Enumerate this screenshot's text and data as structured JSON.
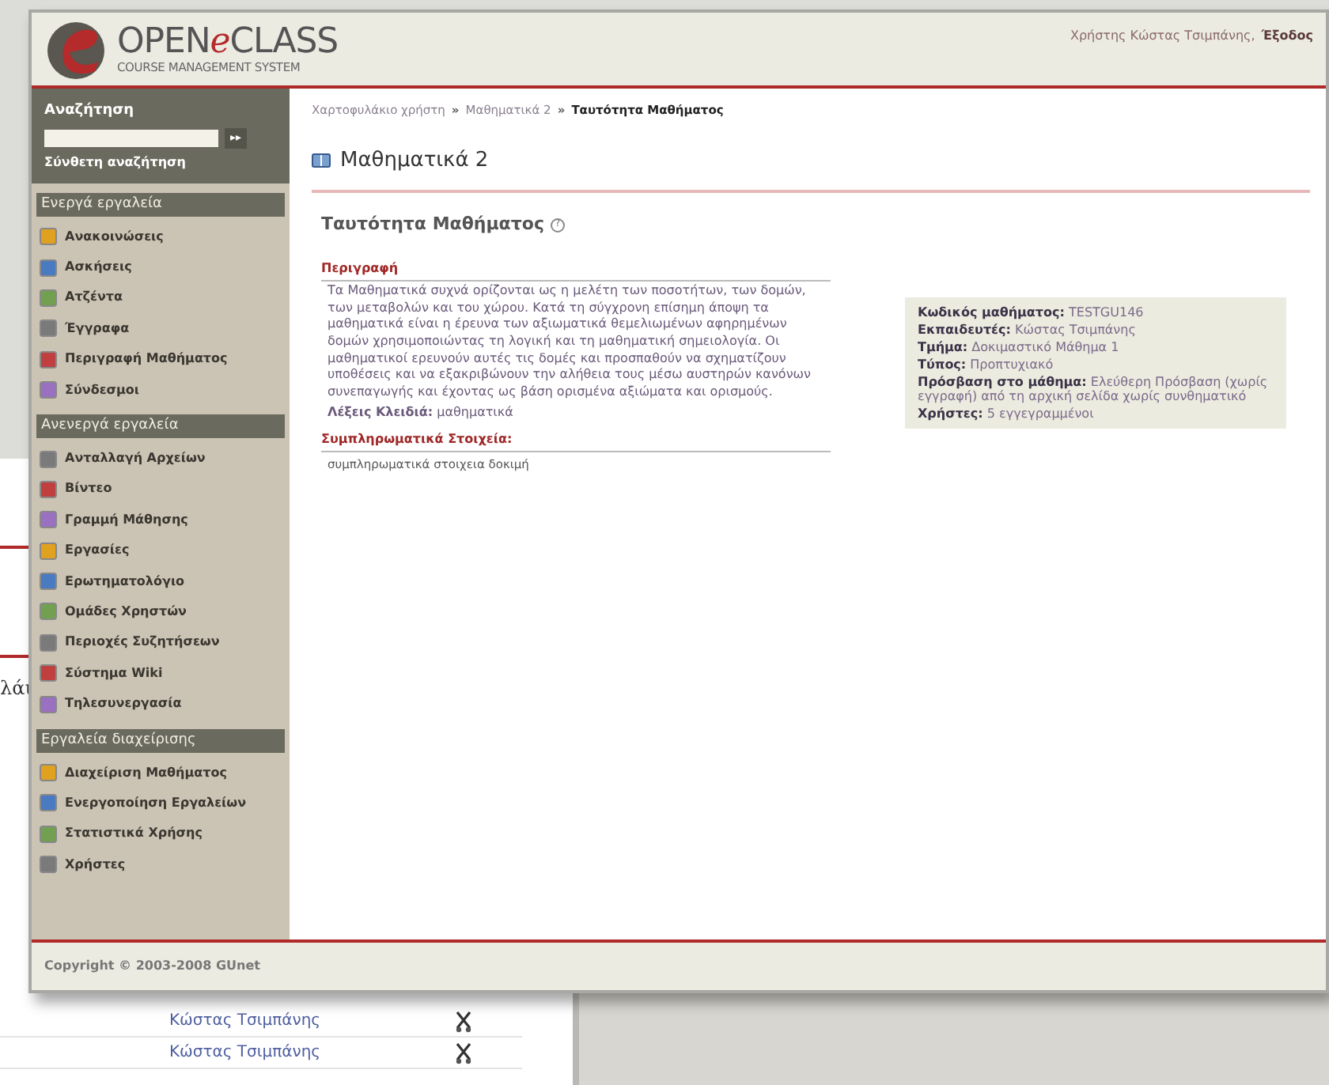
{
  "background_window": {
    "heading_fragment": "λάι",
    "rows": [
      {
        "name": "Κώστας Τσιμπάνης"
      },
      {
        "name": "Κώστας Τσιμπάνης"
      }
    ]
  },
  "header": {
    "logo_open": "OPEN",
    "logo_e": "e",
    "logo_class": "CLASS",
    "logo_subtitle": "COURSE MANAGEMENT SYSTEM",
    "user_text": "Χρήστης Κώστας Τσιμπάνης,",
    "logout": "Έξοδος"
  },
  "search": {
    "title": "Αναζήτηση",
    "button": "▸▸",
    "advanced": "Σύνθετη αναζήτηση"
  },
  "sidebar": {
    "sections": [
      {
        "title": "Ενεργά εργαλεία",
        "items": [
          "Ανακοινώσεις",
          "Ασκήσεις",
          "Ατζέντα",
          "Έγγραφα",
          "Περιγραφή Μαθήματος",
          "Σύνδεσμοι"
        ]
      },
      {
        "title": "Ανενεργά εργαλεία",
        "items": [
          "Ανταλλαγή Αρχείων",
          "Βίντεο",
          "Γραμμή Μάθησης",
          "Εργασίες",
          "Ερωτηματολόγιο",
          "Ομάδες Χρηστών",
          "Περιοχές Συζητήσεων",
          "Σύστημα Wiki",
          "Τηλεσυνεργασία"
        ]
      },
      {
        "title": "Εργαλεία διαχείρισης",
        "items": [
          "Διαχείριση Μαθήματος",
          "Ενεργοποίηση Εργαλείων",
          "Στατιστικά Χρήσης",
          "Χρήστες"
        ]
      }
    ]
  },
  "breadcrumb": [
    {
      "label": "Χαρτοφυλάκιο χρήστη",
      "current": false
    },
    {
      "label": "Μαθηματικά 2",
      "current": false
    },
    {
      "label": "Ταυτότητα Μαθήματος",
      "current": true
    }
  ],
  "breadcrumb_separator": "»",
  "course_title": "Μαθηματικά 2",
  "page_title": "Ταυτότητα Μαθήματος",
  "help_mark": "?",
  "description": {
    "heading": "Περιγραφή",
    "text": "Τα Μαθηματικά συχνά ορίζονται ως η μελέτη των ποσοτήτων, των δομών, των μεταβολών και του χώρου. Κατά τη σύγχρονη επίσημη άποψη τα μαθηματικά είναι η έρευνα των αξιωματικά θεμελιωμένων αφηρημένων δομών χρησιμοποιώντας τη λογική και τη μαθηματική σημειολογία. Οι μαθηματικοί ερευνούν αυτές τις δομές και προσπαθούν να σχηματίζουν υποθέσεις και να εξακριβώνουν την αλήθεια τους μέσω αυστηρών κανόνων συνεπαγωγής και έχοντας ως βάση ορισμένα αξιώματα και ορισμούς.",
    "keywords": "**Λέξεις Κλειδιά:** μαθηματικά"
  },
  "supplementary": {
    "heading": "Συμπληρωματικά Στοιχεία:",
    "text": "συμπληρωματικά στοιχεια δοκιμή"
  },
  "info": [
    {
      "label": "Κωδικός μαθήματος:",
      "value": "TESTGU146"
    },
    {
      "label": "Εκπαιδευτές:",
      "value": "Κώστας Τσιμπάνης"
    },
    {
      "label": "Τμήμα:",
      "value": "Δοκιμαστικό Μάθημα 1"
    },
    {
      "label": "Τύπος:",
      "value": "Προπτυχιακό"
    },
    {
      "label": "Πρόσβαση στο μάθημα:",
      "value": "Ελεύθερη Πρόσβαση (χωρίς εγγραφή) από τη αρχική σελίδα χωρίς συνθηματικό"
    },
    {
      "label": "Χρήστες:",
      "value": "5 εγγεγραμμένοι"
    }
  ],
  "footer": "Copyright © 2003-2008 GUnet"
}
